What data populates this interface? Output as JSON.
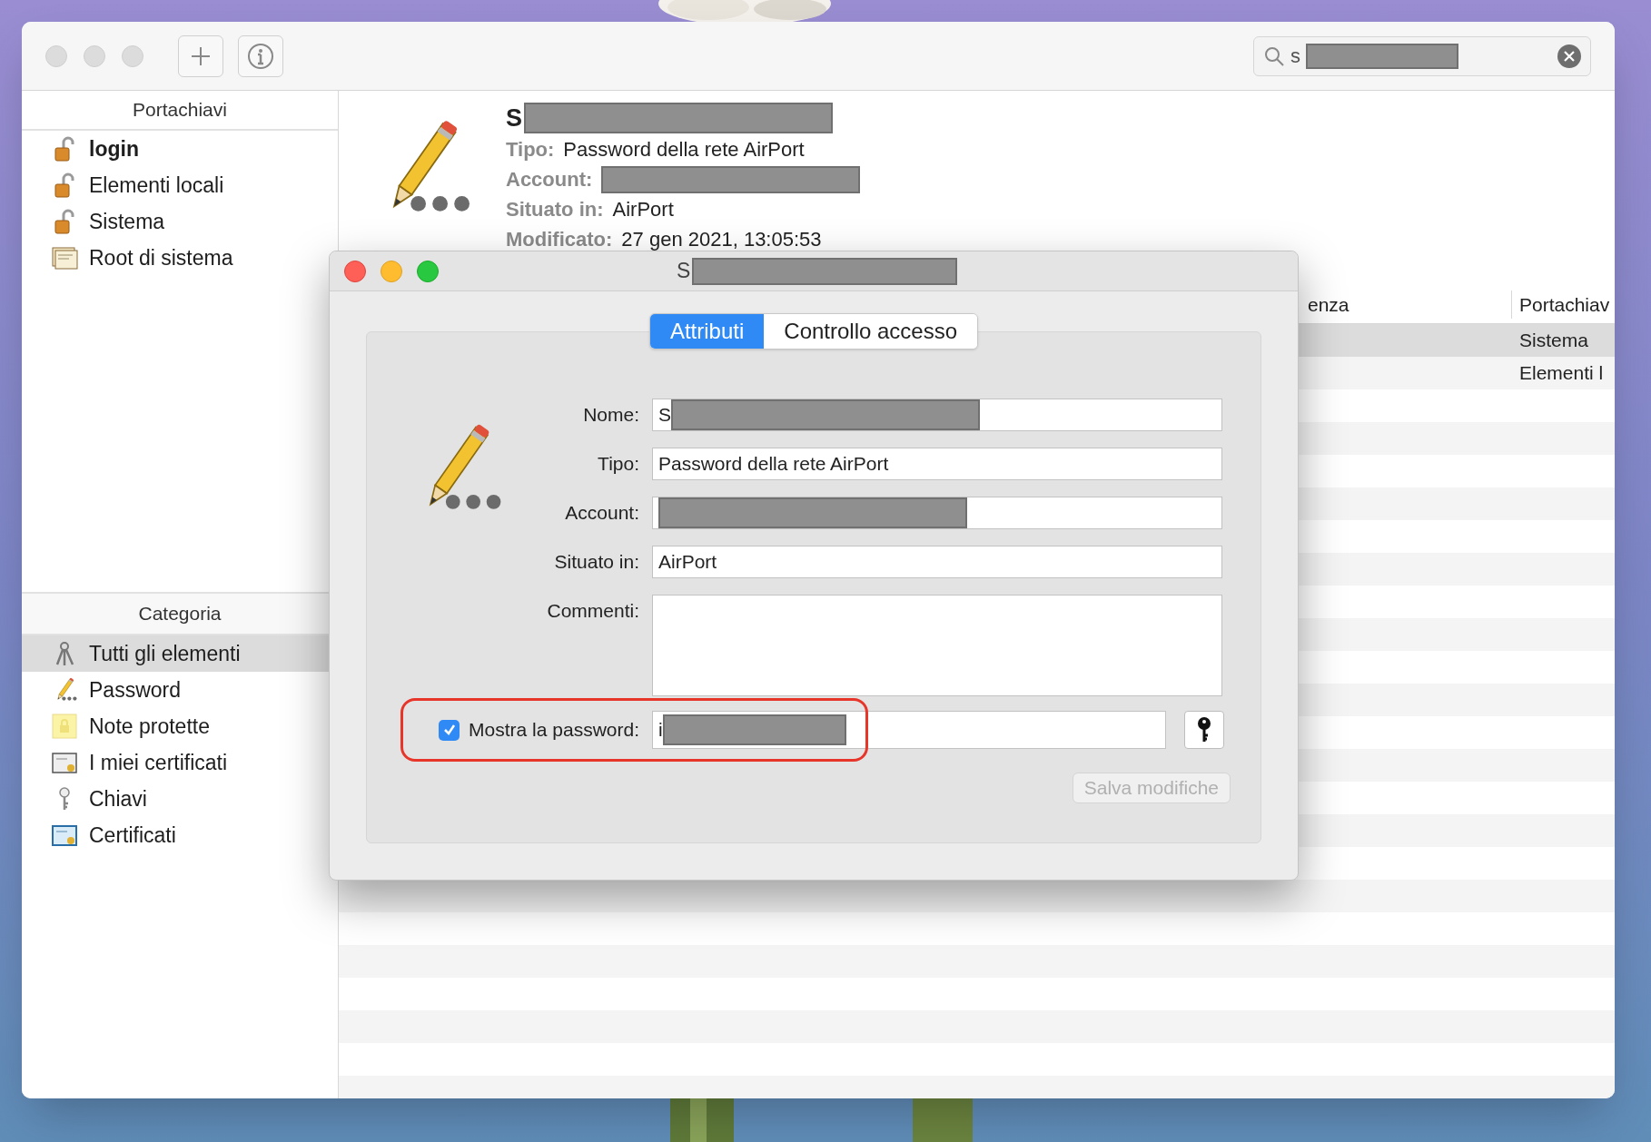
{
  "toolbar": {
    "search": {
      "value": "s",
      "redacted": true
    }
  },
  "sidebar": {
    "keychains": {
      "header": "Portachiavi",
      "items": [
        {
          "label": "login",
          "kind": "lock",
          "default": true,
          "selected": false
        },
        {
          "label": "Elementi locali",
          "kind": "lock",
          "default": false,
          "selected": false
        },
        {
          "label": "Sistema",
          "kind": "lock",
          "default": false,
          "selected": false
        },
        {
          "label": "Root di sistema",
          "kind": "certificates",
          "default": false,
          "selected": false
        }
      ]
    },
    "categories": {
      "header": "Categoria",
      "items": [
        {
          "label": "Tutti gli elementi",
          "kind": "keys",
          "selected": true
        },
        {
          "label": "Password",
          "kind": "password",
          "selected": false
        },
        {
          "label": "Note protette",
          "kind": "note",
          "selected": false
        },
        {
          "label": "I miei certificati",
          "kind": "my-certificate",
          "selected": false
        },
        {
          "label": "Chiavi",
          "kind": "key",
          "selected": false
        },
        {
          "label": "Certificati",
          "kind": "certificate",
          "selected": false
        }
      ]
    }
  },
  "detail": {
    "title": "S",
    "title_redacted": true,
    "fields": [
      {
        "label": "Tipo:",
        "value": "Password della rete AirPort",
        "redacted": false
      },
      {
        "label": "Account:",
        "redacted": true
      },
      {
        "label": "Situato in:",
        "value": "AirPort",
        "redacted": false
      },
      {
        "label": "Modificato:",
        "value": "27 gen 2021, 13:05:53",
        "redacted": false
      }
    ]
  },
  "table": {
    "columns": [
      "enza",
      "Portachiav"
    ],
    "rows": [
      {
        "column_2": "Sistema",
        "selected": true
      },
      {
        "column_2": "Elementi l",
        "selected": false
      }
    ]
  },
  "dialog": {
    "title": "S",
    "title_redacted": true,
    "tabs": [
      {
        "label": "Attributi",
        "selected": true
      },
      {
        "label": "Controllo accesso",
        "selected": false
      }
    ],
    "fields": [
      {
        "label": "Nome:",
        "kind": "text",
        "value": "S",
        "redacted": true
      },
      {
        "label": "Tipo:",
        "kind": "text",
        "value": "Password della rete AirPort",
        "redacted": false
      },
      {
        "label": "Account:",
        "kind": "text",
        "redacted": true
      },
      {
        "label": "Situato in:",
        "kind": "text",
        "value": "AirPort",
        "redacted": false
      },
      {
        "label": "Commenti:",
        "kind": "textarea"
      }
    ],
    "show_password": {
      "label": "Mostra la password:",
      "checked": true,
      "value": "i",
      "redacted": true,
      "highlighted": true
    },
    "save_button": {
      "label": "Salva modifiche",
      "disabled": true
    }
  }
}
